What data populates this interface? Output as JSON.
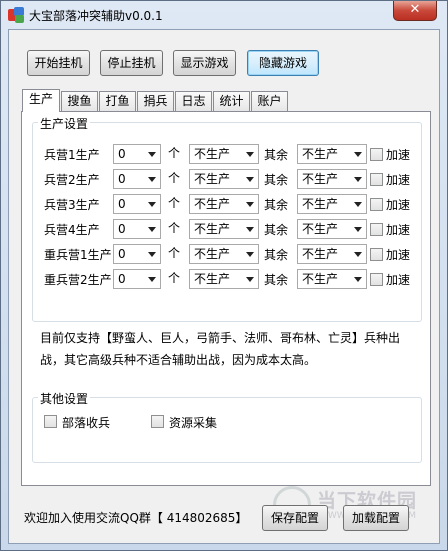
{
  "window": {
    "title": "大宝部落冲突辅助v0.0.1",
    "close_glyph": "✕"
  },
  "toolbar": {
    "start": "开始挂机",
    "stop": "停止挂机",
    "show": "显示游戏",
    "hide": "隐藏游戏"
  },
  "tabs": [
    "生产",
    "搜鱼",
    "打鱼",
    "捐兵",
    "日志",
    "统计",
    "账户"
  ],
  "production": {
    "group_title": "生产设置",
    "unit_label": "个",
    "rest_label": "其余",
    "speed_label": "加速",
    "rows": [
      {
        "label": "兵营1生产",
        "count": "0",
        "produce": "不生产",
        "rest": "不生产"
      },
      {
        "label": "兵营2生产",
        "count": "0",
        "produce": "不生产",
        "rest": "不生产"
      },
      {
        "label": "兵营3生产",
        "count": "0",
        "produce": "不生产",
        "rest": "不生产"
      },
      {
        "label": "兵营4生产",
        "count": "0",
        "produce": "不生产",
        "rest": "不生产"
      },
      {
        "label": "重兵营1生产",
        "count": "0",
        "produce": "不生产",
        "rest": "不生产"
      },
      {
        "label": "重兵营2生产",
        "count": "0",
        "produce": "不生产",
        "rest": "不生产"
      }
    ],
    "note": "目前仅支持【野蛮人、巨人，弓箭手、法师、哥布林、亡灵】兵种出战，其它高级兵种不适合辅助出战，因为成本太高。"
  },
  "other": {
    "group_title": "其他设置",
    "tribe": "部落收兵",
    "resource": "资源采集"
  },
  "footer": {
    "text": "欢迎加入使用交流QQ群【 414802685】",
    "save": "保存配置",
    "load": "加载配置"
  },
  "watermark": {
    "text": "当下软件园",
    "sub": "WWW.DOWNXIA.COM"
  }
}
